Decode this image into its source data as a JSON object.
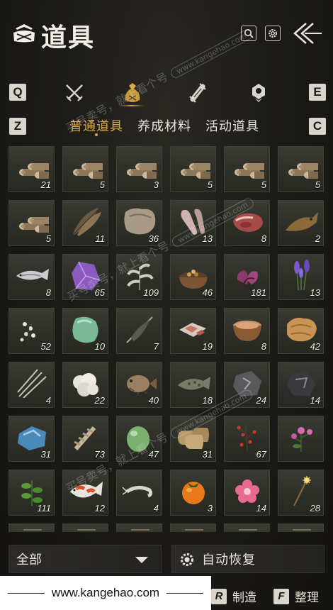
{
  "header": {
    "title": "道具",
    "logo_icon": "bag-icon",
    "search_icon": "search-icon",
    "settings_icon": "gear-icon",
    "back_icon": "back-arrows-icon"
  },
  "categories": {
    "left_key": "Q",
    "right_key": "E",
    "items": [
      {
        "icon": "crossed-swords-icon"
      },
      {
        "icon": "pouch-icon",
        "active": true
      },
      {
        "icon": "scroll-icon"
      },
      {
        "icon": "gem-icon"
      }
    ]
  },
  "tabs": {
    "left_key": "Z",
    "right_key": "C",
    "items": [
      {
        "label": "普通道具",
        "active": true
      },
      {
        "label": "养成材料"
      },
      {
        "label": "活动道具"
      }
    ]
  },
  "items": [
    {
      "icon": "logs-icon",
      "qty": "21"
    },
    {
      "icon": "logs-icon",
      "qty": "5"
    },
    {
      "icon": "logs-icon",
      "qty": "3"
    },
    {
      "icon": "logs-icon",
      "qty": "5"
    },
    {
      "icon": "logs-icon",
      "qty": "5"
    },
    {
      "icon": "logs-icon",
      "qty": "5"
    },
    {
      "icon": "logs-icon",
      "qty": "5"
    },
    {
      "icon": "feather-icon",
      "qty": "11"
    },
    {
      "icon": "pelt-icon",
      "qty": "36"
    },
    {
      "icon": "fur-icon",
      "qty": "13"
    },
    {
      "icon": "raw-meat-icon",
      "qty": "8"
    },
    {
      "icon": "fish-icon",
      "qty": "2"
    },
    {
      "icon": "silver-fish-icon",
      "qty": "8"
    },
    {
      "icon": "amethyst-icon",
      "qty": "65"
    },
    {
      "icon": "herb-icon",
      "qty": "109"
    },
    {
      "icon": "seed-bowl-icon",
      "qty": "46"
    },
    {
      "icon": "purple-bulb-icon",
      "qty": "181"
    },
    {
      "icon": "lavender-icon",
      "qty": "13"
    },
    {
      "icon": "white-flower-icon",
      "qty": "52"
    },
    {
      "icon": "jade-stone-icon",
      "qty": "10"
    },
    {
      "icon": "dark-quill-icon",
      "qty": "7"
    },
    {
      "icon": "meat-slices-icon",
      "qty": "19"
    },
    {
      "icon": "soup-bowl-icon",
      "qty": "8"
    },
    {
      "icon": "hide-icon",
      "qty": "42"
    },
    {
      "icon": "grass-blades-icon",
      "qty": "4"
    },
    {
      "icon": "cotton-icon",
      "qty": "22"
    },
    {
      "icon": "pufferfish-icon",
      "qty": "40"
    },
    {
      "icon": "spotted-fish-icon",
      "qty": "18"
    },
    {
      "icon": "ore-icon",
      "qty": "24"
    },
    {
      "icon": "dark-ore-icon",
      "qty": "14"
    },
    {
      "icon": "blue-crystal-icon",
      "qty": "31"
    },
    {
      "icon": "bone-icon",
      "qty": "73"
    },
    {
      "icon": "green-egg-icon",
      "qty": "47"
    },
    {
      "icon": "grain-sacks-icon",
      "qty": "31"
    },
    {
      "icon": "red-berry-branch-icon",
      "qty": "67"
    },
    {
      "icon": "pink-flower-plant-icon",
      "qty": ""
    },
    {
      "icon": "green-herb-icon",
      "qty": "111"
    },
    {
      "icon": "koi-icon",
      "qty": "12"
    },
    {
      "icon": "shrimp-icon",
      "qty": "4"
    },
    {
      "icon": "persimmon-icon",
      "qty": "3"
    },
    {
      "icon": "pink-blossom-icon",
      "qty": "14"
    },
    {
      "icon": "sparkler-icon",
      "qty": "28"
    },
    {
      "icon": "partial-icon",
      "qty": ""
    },
    {
      "icon": "partial-icon",
      "qty": ""
    },
    {
      "icon": "partial-icon",
      "qty": ""
    },
    {
      "icon": "partial-icon",
      "qty": ""
    },
    {
      "icon": "partial-icon",
      "qty": ""
    },
    {
      "icon": "partial-icon",
      "qty": ""
    }
  ],
  "bottom": {
    "filter_label": "全部",
    "auto_label": "自动恢复",
    "craft_key": "R",
    "craft_label": "制造",
    "sort_key": "F",
    "sort_label": "整理"
  },
  "watermark": {
    "text": "买号卖号，就上看个号",
    "url": "www.kangehao.com",
    "banner_url": "www.kangehao.com"
  }
}
